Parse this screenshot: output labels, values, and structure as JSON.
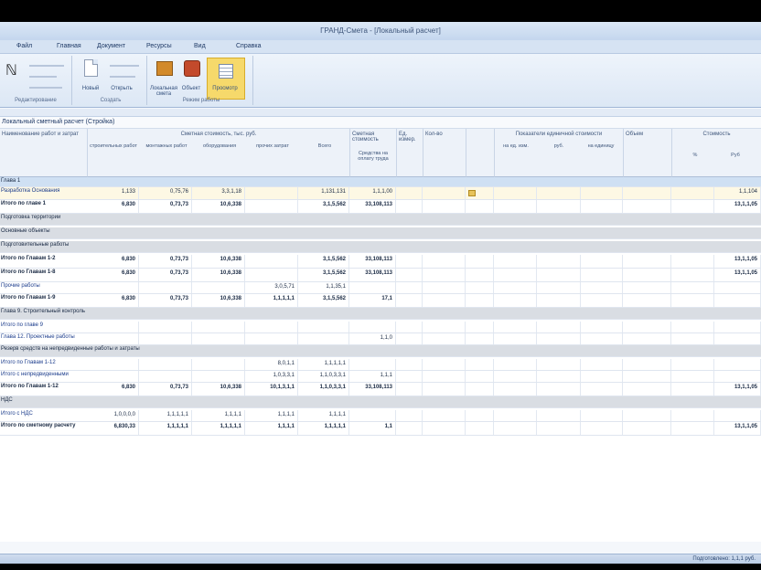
{
  "window": {
    "title": "ГРАНД-Смета - [Локальный расчет]"
  },
  "menu": {
    "items": [
      "Файл",
      "Главная",
      "Документ",
      "Ресурсы",
      "Вид",
      "Справка"
    ]
  },
  "ribbon": {
    "groups": [
      {
        "label": "Редактирование",
        "buttons": [
          "Вставить",
          "Вырезать"
        ]
      },
      {
        "label": "Создать",
        "buttons": [
          "Новый",
          "Открыть"
        ]
      },
      {
        "label": "Режим работы",
        "buttons": [
          "Локальная смета",
          "Объект",
          "Просмотр"
        ]
      }
    ]
  },
  "path": {
    "text": "Локальный сметный расчет (Стройка)"
  },
  "grid": {
    "header": {
      "name": "Наименование работ и затрат",
      "group1": "Сметная стоимость, тыс. руб.",
      "group1_subs": [
        "строительных работ",
        "монтажных работ",
        "оборудования",
        "прочих затрат",
        "Всего"
      ],
      "col_total": "Сметная стоимость",
      "col_wage": "Средства на оплату труда",
      "col_unit": "Ед. измер.",
      "col_qty": "Кол-во",
      "group2": "Показатели единичной стоимости",
      "group2_subs": [
        "на ед. изм.",
        "руб.",
        "на единицу"
      ],
      "col_norm": "Объем",
      "group3": "Стоимость",
      "group3_subs": [
        "%",
        "Руб"
      ]
    },
    "rows": [
      {
        "label": "Глава 1",
        "vals": [
          "",
          "",
          "",
          "",
          "",
          "",
          ""
        ],
        "kind": "section"
      },
      {
        "label": "Разработка Основания",
        "vals": [
          "1,133",
          "0,75,76",
          "3,3,1,18",
          "",
          "1,131,131",
          "1,1,1,00",
          "1,1,104"
        ],
        "kind": "yellow"
      },
      {
        "label": "Итого по главе 1",
        "vals": [
          "6,830",
          "0,73,73",
          "10,6,338",
          "",
          "3,1,5,562",
          "33,108,113",
          "13,1,1,05"
        ],
        "kind": "bold"
      },
      {
        "label": "Подготовка территории",
        "vals": [],
        "kind": "gray"
      },
      {
        "label": "Основные объекты",
        "vals": [],
        "kind": "gray"
      },
      {
        "label": "Подготовительные работы",
        "vals": [],
        "kind": "gray"
      },
      {
        "label": "Итого по Главам 1-2",
        "vals": [
          "6,830",
          "0,73,73",
          "10,6,338",
          "",
          "3,1,5,562",
          "33,108,113",
          "13,1,1,05"
        ],
        "kind": "bold"
      },
      {
        "label": "Итого по Главам 1-8",
        "vals": [
          "6,830",
          "0,73,73",
          "10,6,338",
          "",
          "3,1,5,562",
          "33,108,113",
          "13,1,1,05"
        ],
        "kind": "bold"
      },
      {
        "label": "Прочие работы",
        "vals": [
          "",
          "",
          "",
          "3,0,5,71",
          "1,1,35,1",
          "",
          ""
        ],
        "kind": "normal"
      },
      {
        "label": "Итого по Главам 1-9",
        "vals": [
          "6,830",
          "0,73,73",
          "10,6,338",
          "1,1,1,1,1",
          "3,1,5,562",
          "17,1",
          ""
        ],
        "kind": "bold"
      },
      {
        "label": "Глава 9. Строительный контроль",
        "vals": [],
        "kind": "gray"
      },
      {
        "label": "Итого по главе 9",
        "vals": [
          "",
          "",
          "",
          "",
          "",
          "",
          ""
        ],
        "kind": "normal"
      },
      {
        "label": "Глава 12. Проектные работы",
        "vals": [
          "",
          "",
          "",
          "",
          "",
          "1,1,0",
          ""
        ],
        "kind": "normal"
      },
      {
        "label": "Резерв средств на непредвиденные работы и затраты",
        "vals": [],
        "kind": "gray"
      },
      {
        "label": "Итого по Главам 1-12",
        "vals": [
          "",
          "",
          "",
          "8,0,1,1",
          "1,1,1,1,1",
          "",
          ""
        ],
        "kind": "normal"
      },
      {
        "label": "Итого с непредвиденными",
        "vals": [
          "",
          "",
          "",
          "1,0,3,3,1",
          "1,1,0,3,3,1",
          "1,1,1",
          ""
        ],
        "kind": "normal"
      },
      {
        "label": "Итого по Главам 1-12",
        "vals": [
          "6,830",
          "0,73,73",
          "10,6,338",
          "10,1,3,1,1",
          "1,1,0,3,3,1",
          "33,108,113",
          "13,1,1,05"
        ],
        "kind": "bold"
      },
      {
        "label": "НДС",
        "vals": [],
        "kind": "gray"
      },
      {
        "label": "Итого с НДС",
        "vals": [
          "1,0,0,0,0",
          "1,1,1,1,1",
          "1,1,1,1",
          "1,1,1,1",
          "1,1,1,1",
          "",
          ""
        ],
        "kind": "normal"
      },
      {
        "label": "Итого по сметному расчету",
        "vals": [
          "6,830,33",
          "1,1,1,1,1",
          "1,1,1,1,1",
          "1,1,1,1",
          "1,1,1,1,1",
          "1,1",
          "13,1,1,05"
        ],
        "kind": "bold"
      }
    ]
  },
  "statusbar": {
    "text": "Подготовлено: 1,1,1 руб."
  },
  "colors": {
    "accent": "#f6d96b",
    "header_bg": "#edf2f9",
    "gray_row": "#d9dde3"
  }
}
